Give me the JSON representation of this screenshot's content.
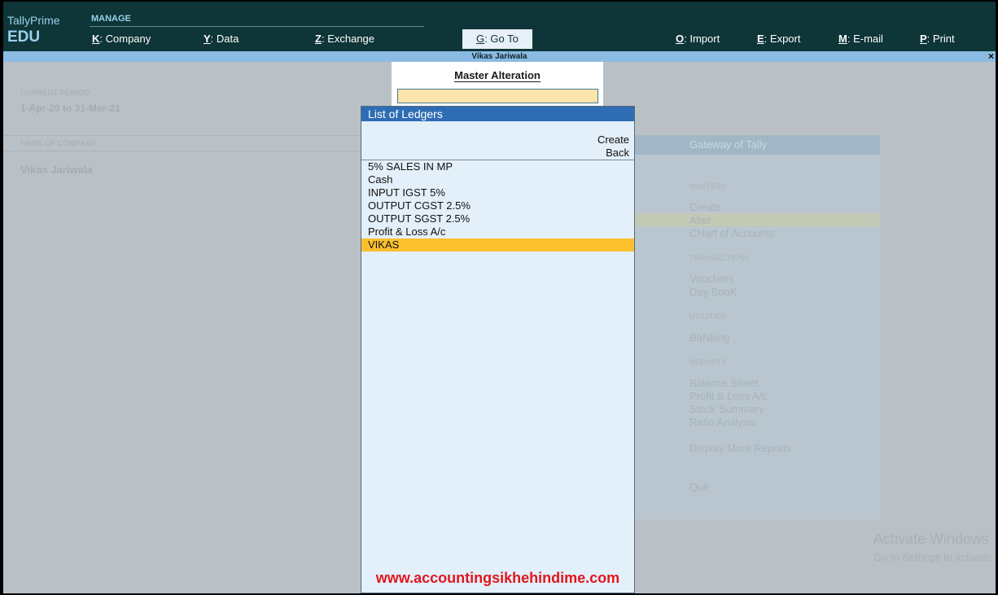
{
  "brand": {
    "name": "TallyPrime",
    "edition": "EDU"
  },
  "header": {
    "section_label": "MANAGE",
    "menu": [
      {
        "key": "K",
        "label": "Company"
      },
      {
        "key": "Y",
        "label": "Data"
      },
      {
        "key": "Z",
        "label": "Exchange"
      },
      {
        "key": "G",
        "label": "Go To"
      },
      {
        "key": "O",
        "label": "Import"
      },
      {
        "key": "E",
        "label": "Export"
      },
      {
        "key": "M",
        "label": "E-mail"
      },
      {
        "key": "P",
        "label": "Print"
      }
    ]
  },
  "window": {
    "title": "Vikas Jariwala",
    "close_glyph": "×"
  },
  "company_info": {
    "period_label": "CURRENT PERIOD",
    "period_value": "1-Apr-20 to 31-Mar-21",
    "name_label": "NAME OF COMPANY",
    "name_value": "Vikas Jariwala"
  },
  "gateway": {
    "title": "Gateway of Tally",
    "sections": [
      {
        "label": "MASTERS",
        "items": [
          "Create",
          "Alter",
          "CHart of Accounts"
        ]
      },
      {
        "label": "TRANSACTIONS",
        "items": [
          "Vouchers",
          "Day BooK"
        ]
      },
      {
        "label": "UTILITIES",
        "items": [
          "BaNking"
        ]
      },
      {
        "label": "REPORTS",
        "items": [
          "Balance Sheet",
          "Profit & Loss A/c",
          "Stock Summary",
          "Ratio Analysis",
          "Display More Reports"
        ]
      }
    ],
    "quit": "Quit",
    "highlighted": "Alter"
  },
  "master_alteration": {
    "title": "Master Alteration",
    "input_value": ""
  },
  "ledger_list": {
    "title": "List of Ledgers",
    "actions": [
      "Create",
      "Back"
    ],
    "items": [
      "5% SALES IN MP",
      "Cash",
      "INPUT IGST 5%",
      "OUTPUT CGST 2.5%",
      "OUTPUT SGST 2.5%",
      "Profit & Loss A/c",
      "VIKAS"
    ],
    "selected": "VIKAS",
    "watermark": "www.accountingsikhehindime.com"
  },
  "os_notice": {
    "line1": "Activate Windows",
    "line2": "Go to Settings to activate Windows."
  },
  "colors": {
    "header_bg": "#0e3538",
    "titlebar_bg": "#8bbbe2",
    "list_head_bg": "#2e6db4",
    "selected_bg": "#fcc02e",
    "input_bg": "#fde3ad"
  }
}
